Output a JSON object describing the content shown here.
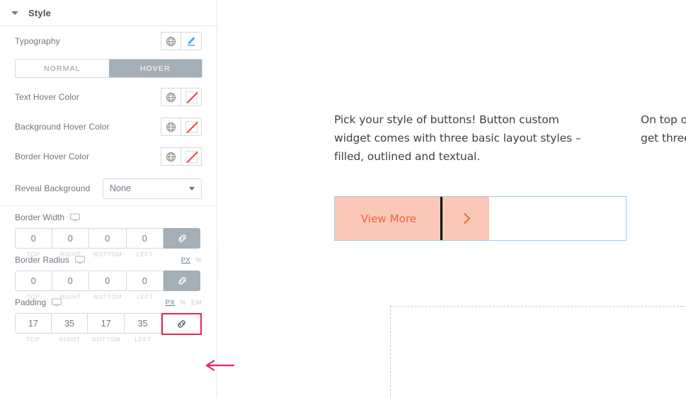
{
  "panel": {
    "header": {
      "title": "Style",
      "caret_icon": "caret-down-icon"
    },
    "typography": {
      "label": "Typography",
      "globe_icon": "globe-icon",
      "edit_icon": "pencil-icon"
    },
    "state_toggle": {
      "normal_label": "NORMAL",
      "hover_label": "HOVER",
      "active": "HOVER"
    },
    "color_rows": [
      {
        "label": "Text Hover Color",
        "globe_icon": "globe-icon",
        "swatch_icon": "no-color-swatch-icon"
      },
      {
        "label": "Background Hover Color",
        "globe_icon": "globe-icon",
        "swatch_icon": "no-color-swatch-icon"
      },
      {
        "label": "Border Hover Color",
        "globe_icon": "globe-icon",
        "swatch_icon": "no-color-swatch-icon"
      }
    ],
    "reveal_background": {
      "label": "Reveal Background",
      "value": "None",
      "caret_icon": "chevron-down-icon"
    },
    "dimension_groups": [
      {
        "title": "Border Width",
        "device_icon": "desktop-monitor-icon",
        "units": [],
        "values": [
          "0",
          "0",
          "0",
          "0"
        ],
        "sublabels": [
          "TOP",
          "RIGHT",
          "BOTTOM",
          "LEFT"
        ],
        "link_icon": "chain-link-icon",
        "link_state": "linked",
        "highlighted": false
      },
      {
        "title": "Border Radius",
        "device_icon": "desktop-monitor-icon",
        "units": [
          {
            "label": "PX",
            "active": true
          },
          {
            "label": "%",
            "active": false
          }
        ],
        "values": [
          "0",
          "0",
          "0",
          "0"
        ],
        "sublabels": [
          "TOP",
          "RIGHT",
          "BOTTOM",
          "LEFT"
        ],
        "link_icon": "chain-link-icon",
        "link_state": "linked",
        "highlighted": false
      },
      {
        "title": "Padding",
        "device_icon": "desktop-monitor-icon",
        "units": [
          {
            "label": "PX",
            "active": true
          },
          {
            "label": "%",
            "active": false
          },
          {
            "label": "EM",
            "active": false
          }
        ],
        "values": [
          "17",
          "35",
          "17",
          "35"
        ],
        "sublabels": [
          "TOP",
          "RIGHT",
          "BOTTOM",
          "LEFT"
        ],
        "link_icon": "chain-link-icon",
        "link_state": "unlinked",
        "highlighted": true
      }
    ],
    "collapse_tab": {
      "icon": "chevron-left-icon"
    }
  },
  "preview": {
    "paragraph_left": "Pick your style of buttons! Button custom widget comes with three basic layout styles – filled, outlined and textual.",
    "paragraph_right": "On top of that you also get three standard sizes,",
    "button": {
      "label": "View More",
      "arrow_icon": "chevron-right-icon",
      "selected": true
    },
    "placeholder_box": "empty-dashed-drop-area"
  },
  "annotation": {
    "arrow_icon": "left-pointing-arrow-icon",
    "target": "padding-link-button"
  },
  "colors": {
    "panel_border": "#e6e9ec",
    "label_text": "#6d7882",
    "toggle_active_bg": "#a4afb7",
    "link_btn_bg": "#a4afb7",
    "highlight_border": "#e8244f",
    "annotation_arrow": "#e8245f",
    "button_bg": "#fbc8b7",
    "button_text": "#f4643c",
    "selection_outline": "#8ed2f0",
    "swatch_slash": "#e8453c",
    "pencil_blue": "#3ba9f2"
  }
}
